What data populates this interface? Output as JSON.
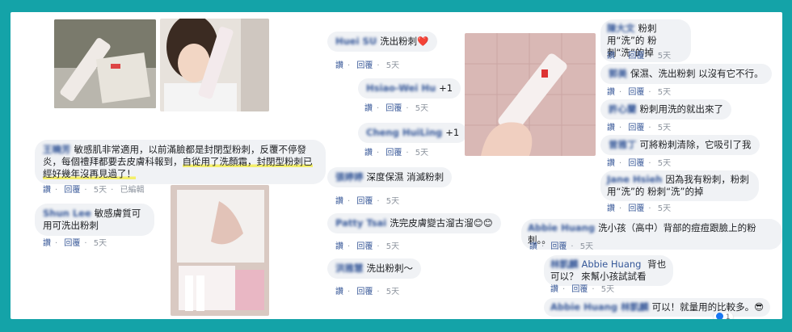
{
  "colors": {
    "frame": "#14a3a8",
    "bubble": "#f0f2f5",
    "link": "#385898",
    "highlight": "#f4ef6a"
  },
  "comments_left": [
    {
      "name": "王曉芳",
      "text": "敏感肌非常適用，以前滿臉都是封閉型粉刺，反覆不停發炎，每個禮拜都要去皮膚科報到，",
      "text_hl": "自從用了洗顏霜，封閉型粉刺已經好幾年沒再見過了！",
      "meta": [
        "讚",
        "回覆",
        "5天",
        "已編輯"
      ]
    },
    {
      "name": "Shun Lee",
      "text": "敏感膚質可用可洗出粉刺",
      "meta": [
        "讚",
        "回覆",
        "5天"
      ]
    }
  ],
  "comments_mid": [
    {
      "name": "Huei SU",
      "text": "洗出粉刺",
      "emoji": "❤️",
      "meta": [
        "讚",
        "回覆",
        "5天"
      ]
    },
    {
      "name": "Hsiao-Wei Hu",
      "text": "+1",
      "meta": [
        "讚",
        "回覆",
        "5天"
      ]
    },
    {
      "name": "Cheng HuiLing",
      "text": "+1",
      "meta": [
        "讚",
        "回覆",
        "5天"
      ]
    },
    {
      "name": "張婷婷",
      "text": "深度保濕 消滅粉刺",
      "meta": [
        "讚",
        "回覆",
        "5天"
      ]
    },
    {
      "name": "Patty Tsai",
      "text": "洗完皮膚變古溜古溜",
      "emoji": "😊😊",
      "meta": [
        "讚",
        "回覆",
        "5天"
      ]
    },
    {
      "name": "洪雅慧",
      "text": "洗出粉刺～",
      "meta": [
        "讚",
        "回覆",
        "5天"
      ]
    }
  ],
  "comments_right": [
    {
      "name": "陳大文",
      "text": "粉刺用“洗”的 粉刺“洗”的掉",
      "meta": [
        "讚",
        "回覆",
        "5天"
      ]
    },
    {
      "name": "郭美",
      "text": "保濕、洗出粉刺 以沒有它不行。",
      "meta": [
        "讚",
        "回覆",
        "5天"
      ]
    },
    {
      "name": "許心蘭",
      "text": "粉刺用洗的就出來了",
      "meta": [
        "讚",
        "回覆",
        "5天"
      ]
    },
    {
      "name": "曾雅丁",
      "text": "可將粉刺清除，它吸引了我",
      "meta": [
        "讚",
        "回覆",
        "5天"
      ]
    },
    {
      "name": "Jane Hsieh",
      "text": "因為我有粉刺，粉刺用“洗”的 粉刺“洗”的掉",
      "meta": [
        "讚",
        "回覆",
        "5天"
      ]
    },
    {
      "name": "Abbie Huang",
      "text": "洗小孩（高中）背部的痘痘跟臉上的粉刺。。",
      "meta": [
        "讚",
        "回覆",
        "5天"
      ]
    },
    {
      "name": "林凱麟",
      "text": "背也可以？ 來幫小孩試試看",
      "mention": "Abbie Huang",
      "meta": [
        "讚",
        "回覆",
        "5天"
      ]
    },
    {
      "name": "Abbie Huang",
      "text": "可以！就量用的比較多。",
      "mention": "林凱麟",
      "emoji": "😎",
      "meta": []
    }
  ],
  "reactions": {
    "count": "1"
  }
}
